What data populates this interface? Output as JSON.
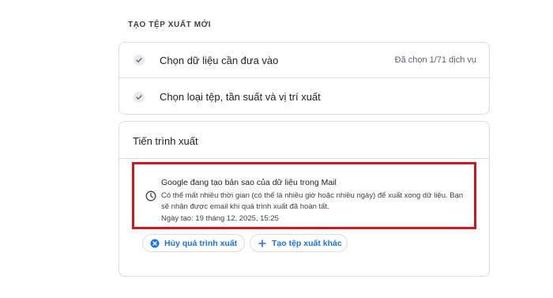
{
  "section": {
    "title": "TẠO TỆP XUẤT MỚI"
  },
  "steps": [
    {
      "label": "Chọn dữ liệu cần đưa vào",
      "status": "Đã chọn 1/71 dịch vụ"
    },
    {
      "label": "Chọn loại tệp, tần suất và vị trí xuất",
      "status": ""
    }
  ],
  "progress": {
    "title": "Tiến trình xuất",
    "heading": "Google đang tạo bản sao của dữ liệu trong Mail",
    "description": "Có thể mất nhiều thời gian (có thể là nhiều giờ hoặc nhiều ngày) để xuất xong dữ liệu. Bạn sẽ nhận được email khi quá trình xuất đã hoàn tất.",
    "date": "Ngày tạo: 19 tháng 12, 2025, 15:25"
  },
  "buttons": {
    "cancel_label": "Hủy quá trình xuất",
    "new_export_label": "Tạo tệp xuất khác"
  },
  "icons": {
    "step_check": "check-icon",
    "status": "clock-icon",
    "cancel": "cancel-circle-icon",
    "new_export": "plus-icon"
  },
  "colors": {
    "accent": "#1a73e8",
    "highlight_border": "#d0171e",
    "border": "#dadce0"
  }
}
